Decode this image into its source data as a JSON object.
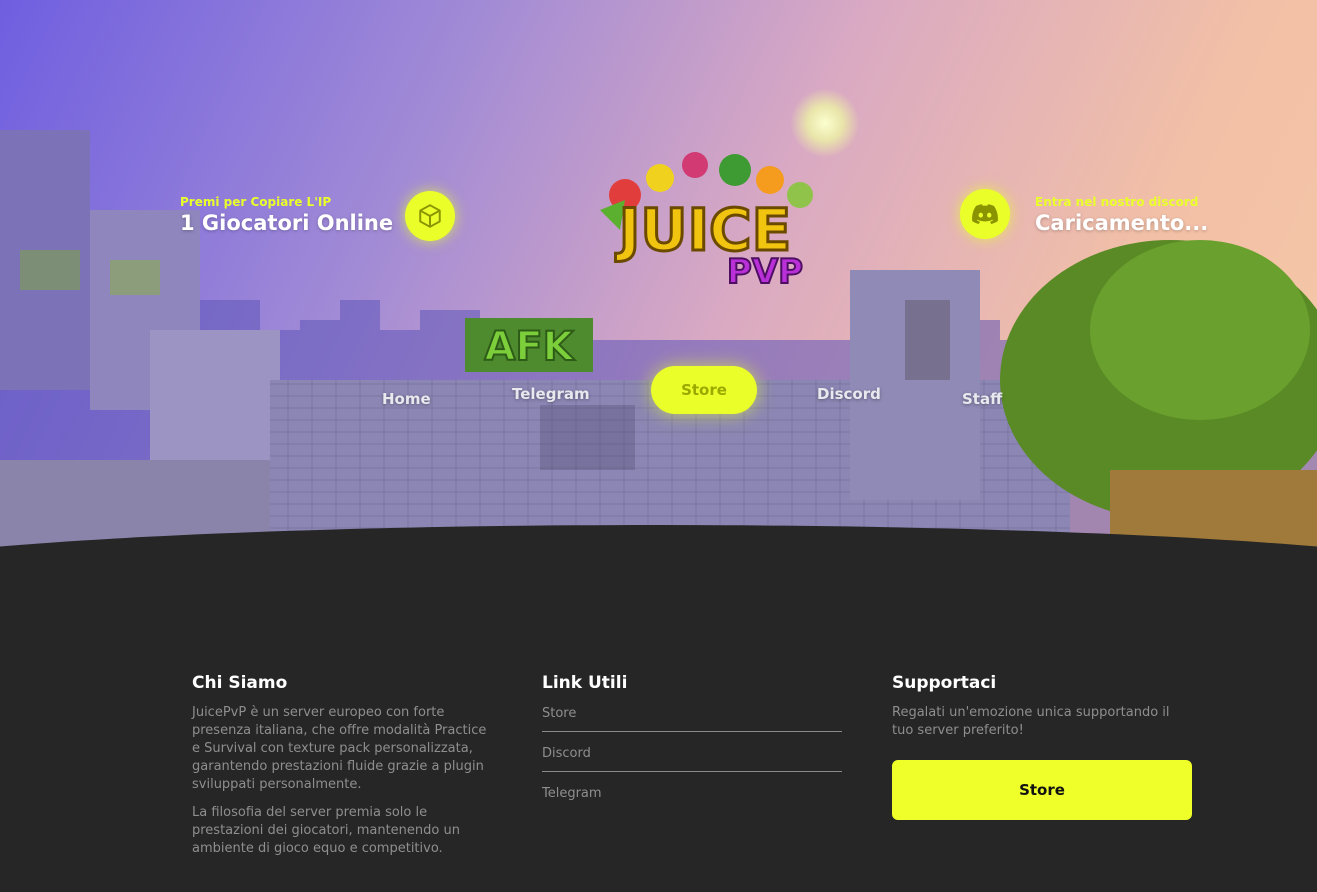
{
  "hero": {
    "left_info": {
      "kicker": "Premi per Copiare L'IP",
      "title": "1 Giocatori Online",
      "icon": "box-icon"
    },
    "right_info": {
      "kicker": "Entra nel nostro discord",
      "title": "Caricamento...",
      "icon": "discord-icon"
    },
    "logo": {
      "line1": "JUICE",
      "line2": "PVP"
    },
    "nav": {
      "home": "Home",
      "telegram": "Telegram",
      "store": "Store",
      "discord": "Discord",
      "staff": "Staff"
    },
    "background_signs": {
      "afk": "AFK"
    }
  },
  "footer": {
    "about": {
      "title": "Chi Siamo",
      "paragraph1": "JuicePvP è un server europeo con forte presenza italiana, che offre modalità Practice e Survival con texture pack personalizzata, garantendo prestazioni fluide grazie a plugin sviluppati personalmente.",
      "paragraph2": "La filosofia del server premia solo le prestazioni dei giocatori, mantenendo un ambiente di gioco equo e competitivo."
    },
    "links": {
      "title": "Link Utili",
      "items": [
        "Store",
        "Discord",
        "Telegram"
      ]
    },
    "support": {
      "title": "Supportaci",
      "text": "Regalati un'emozione unica supportando il tuo server preferito!",
      "button": "Store"
    }
  },
  "colors": {
    "accent": "#eaff2a",
    "footer_bg": "#262626",
    "muted_text": "#8e8e8e"
  }
}
